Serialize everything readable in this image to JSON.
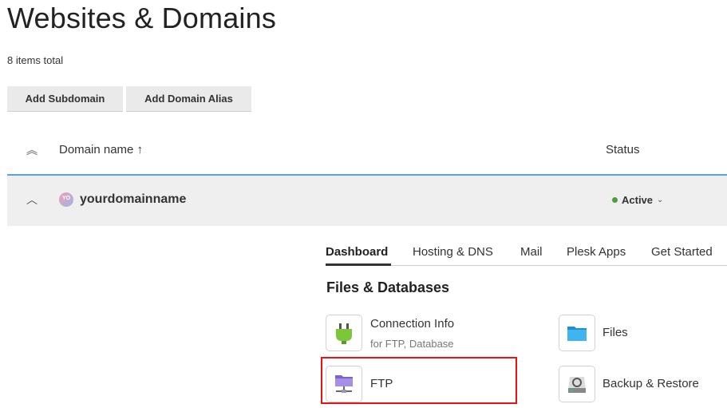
{
  "page": {
    "title": "Websites & Domains",
    "items_total": "8 items total"
  },
  "toolbar": {
    "add_subdomain": "Add Subdomain",
    "add_domain_alias": "Add Domain Alias"
  },
  "table": {
    "col_domain": "Domain name ↑",
    "col_status": "Status",
    "collapse_all_glyph": "︽",
    "row": {
      "domain": "yourdomainname",
      "avatar_text": "YO",
      "status": "Active",
      "status_color": "#4aa033",
      "expand_glyph": "︿"
    }
  },
  "tabs": [
    {
      "label": "Dashboard",
      "active": true
    },
    {
      "label": "Hosting & DNS",
      "active": false
    },
    {
      "label": "Mail",
      "active": false
    },
    {
      "label": "Plesk Apps",
      "active": false
    },
    {
      "label": "Get Started",
      "active": false
    }
  ],
  "section": {
    "title": "Files & Databases",
    "tools": [
      {
        "label": "Connection Info",
        "sublabel": "for FTP, Database",
        "icon": "plug-icon"
      },
      {
        "label": "Files",
        "icon": "folder-icon"
      },
      {
        "label": "FTP",
        "icon": "ftp-folder-icon"
      },
      {
        "label": "Backup & Restore",
        "icon": "backup-icon"
      }
    ]
  },
  "colors": {
    "accent_line": "#5aa4d6",
    "highlight": "#e11111"
  }
}
